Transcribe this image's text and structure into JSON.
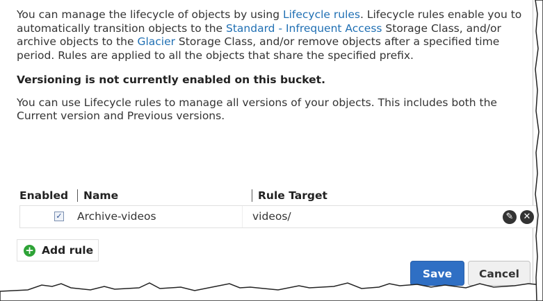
{
  "intro": {
    "t1": "You can manage the lifecycle of objects by using ",
    "link_lifecycle": "Lifecycle rules",
    "t2": ". Lifecycle rules enable you to automatically transition objects to the ",
    "link_standard_ia": "Standard - Infrequent Access",
    "t3": " Storage Class, and/or archive objects to the ",
    "link_glacier": "Glacier",
    "t4": " Storage Class, and/or remove objects after a specified time period. Rules are applied to all the objects that share the specified prefix."
  },
  "versioning_warning": "Versioning is not currently enabled on this bucket.",
  "versioning_info": "You can use Lifecycle rules to manage all versions of your objects. This includes both the Current version and Previous versions.",
  "rules_table": {
    "headers": {
      "enabled": "Enabled",
      "name": "Name",
      "target": "Rule Target"
    },
    "rows": [
      {
        "enabled": true,
        "checkmark": "✓",
        "name": "Archive-videos",
        "target": "videos/"
      }
    ]
  },
  "icons": {
    "edit": "pencil-icon",
    "delete": "close-circle-icon",
    "add": "plus-circle-icon"
  },
  "add_rule_label": "Add rule",
  "buttons": {
    "save": "Save",
    "cancel": "Cancel"
  },
  "colors": {
    "link": "#1f6fb3",
    "primary": "#2f6fc4",
    "add": "#2ea337"
  }
}
